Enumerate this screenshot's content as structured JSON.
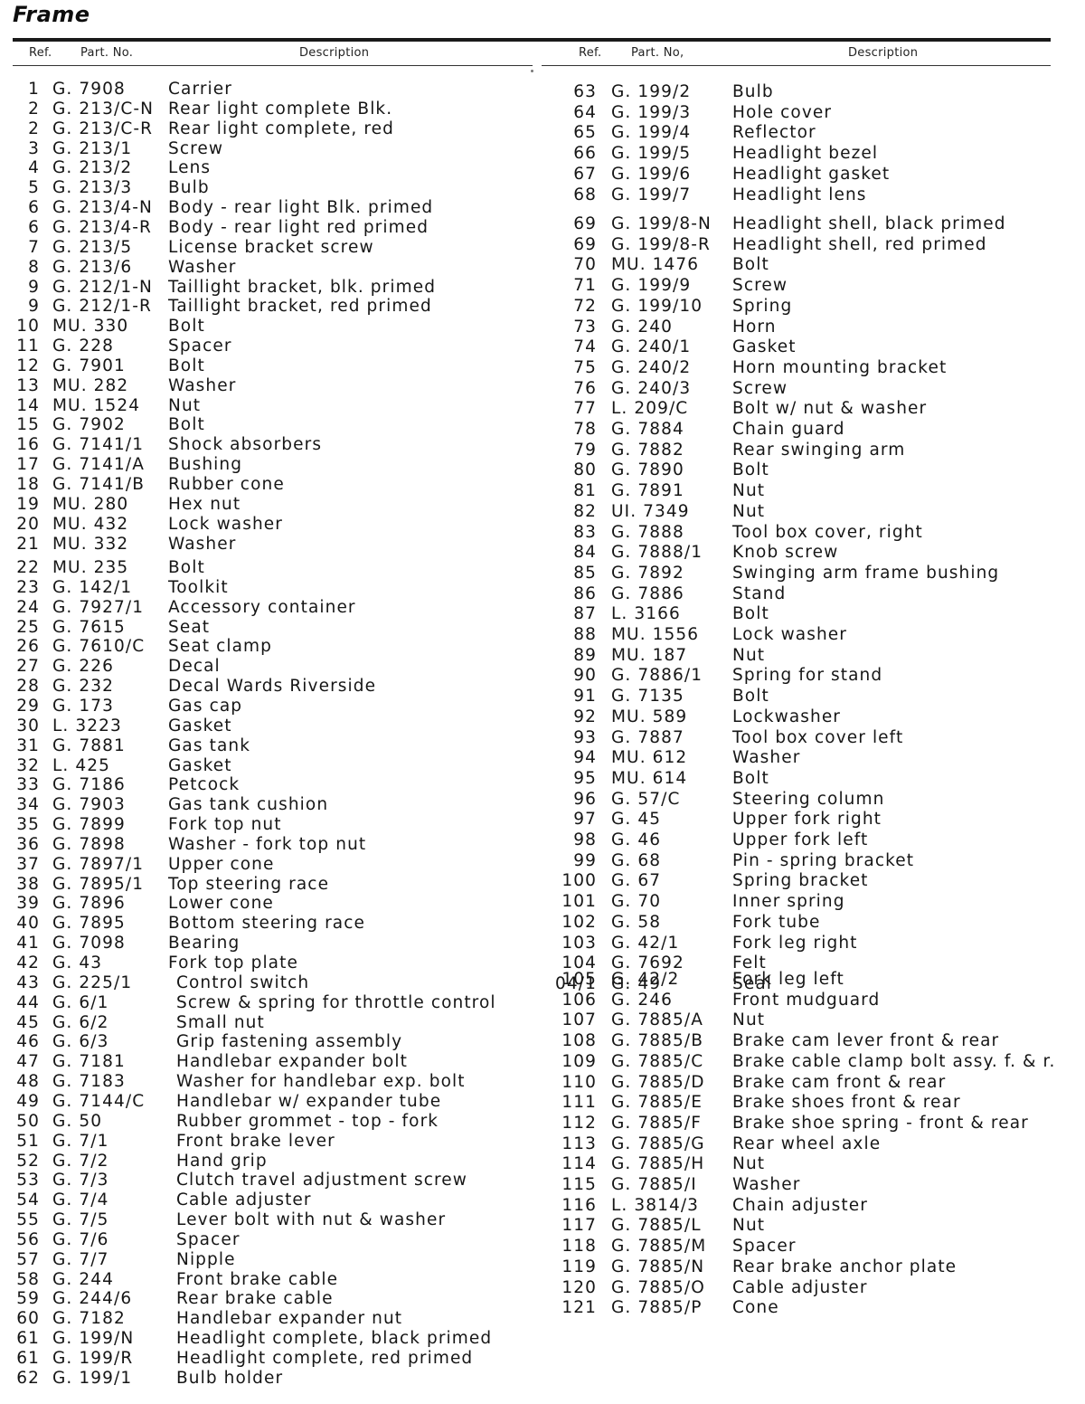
{
  "page": {
    "title": "Frame",
    "headers": {
      "ref": "Ref.",
      "part_no": "Part. No.",
      "description": "Description",
      "part_no_right": "Part. No,"
    }
  },
  "left_column": [
    {
      "ref": "1",
      "part_no": "G. 7908",
      "description": "Carrier"
    },
    {
      "ref": "2",
      "part_no": "G. 213/C-N",
      "description": "Rear light complete Blk."
    },
    {
      "ref": "2",
      "part_no": "G. 213/C-R",
      "description": "Rear light complete, red"
    },
    {
      "ref": "3",
      "part_no": "G. 213/1",
      "description": "Screw"
    },
    {
      "ref": "4",
      "part_no": "G. 213/2",
      "description": "Lens"
    },
    {
      "ref": "5",
      "part_no": "G. 213/3",
      "description": "Bulb"
    },
    {
      "ref": "6",
      "part_no": "G. 213/4-N",
      "description": "Body - rear light Blk. primed"
    },
    {
      "ref": "6",
      "part_no": "G. 213/4-R",
      "description": "Body - rear light red primed"
    },
    {
      "ref": "7",
      "part_no": "G. 213/5",
      "description": "License bracket screw"
    },
    {
      "ref": "8",
      "part_no": "G. 213/6",
      "description": "Washer"
    },
    {
      "ref": "9",
      "part_no": "G. 212/1-N",
      "description": "Taillight bracket, blk. primed"
    },
    {
      "ref": "9",
      "part_no": "G. 212/1-R",
      "description": "Taillight bracket, red primed"
    },
    {
      "ref": "10",
      "part_no": "MU. 330",
      "description": "Bolt"
    },
    {
      "ref": "11",
      "part_no": "G. 228",
      "description": "Spacer"
    },
    {
      "ref": "12",
      "part_no": "G. 7901",
      "description": "Bolt"
    },
    {
      "ref": "13",
      "part_no": "MU. 282",
      "description": "Washer"
    },
    {
      "ref": "14",
      "part_no": "MU. 1524",
      "description": "Nut"
    },
    {
      "ref": "15",
      "part_no": "G. 7902",
      "description": "Bolt"
    },
    {
      "ref": "16",
      "part_no": "G. 7141/1",
      "description": "Shock absorbers"
    },
    {
      "ref": "17",
      "part_no": "G. 7141/A",
      "description": "Bushing"
    },
    {
      "ref": "18",
      "part_no": "G. 7141/B",
      "description": "Rubber cone"
    },
    {
      "ref": "19",
      "part_no": "MU. 280",
      "description": "Hex nut"
    },
    {
      "ref": "20",
      "part_no": "MU. 432",
      "description": "Lock washer"
    },
    {
      "ref": "21",
      "part_no": "MU. 332",
      "description": "Washer"
    },
    {
      "ref": "22",
      "part_no": "MU. 235",
      "description": "Bolt"
    },
    {
      "ref": "23",
      "part_no": "G. 142/1",
      "description": "Toolkit"
    },
    {
      "ref": "24",
      "part_no": "G. 7927/1",
      "description": "Accessory container"
    },
    {
      "ref": "25",
      "part_no": "G. 7615",
      "description": "Seat"
    },
    {
      "ref": "26",
      "part_no": "G. 7610/C",
      "description": "Seat clamp"
    },
    {
      "ref": "27",
      "part_no": "G. 226",
      "description": "Decal"
    },
    {
      "ref": "28",
      "part_no": "G. 232",
      "description": "Decal Wards Riverside"
    },
    {
      "ref": "29",
      "part_no": "G. 173",
      "description": "Gas cap"
    },
    {
      "ref": "30",
      "part_no": "L. 3223",
      "description": "Gasket"
    },
    {
      "ref": "31",
      "part_no": "G. 7881",
      "description": "Gas tank"
    },
    {
      "ref": "32",
      "part_no": "L. 425",
      "description": "Gasket"
    },
    {
      "ref": "33",
      "part_no": "G. 7186",
      "description": "Petcock"
    },
    {
      "ref": "34",
      "part_no": "G. 7903",
      "description": "Gas tank cushion"
    },
    {
      "ref": "35",
      "part_no": "G. 7899",
      "description": "Fork top nut"
    },
    {
      "ref": "36",
      "part_no": "G. 7898",
      "description": "Washer - fork top nut"
    },
    {
      "ref": "37",
      "part_no": "G. 7897/1",
      "description": "Upper cone"
    },
    {
      "ref": "38",
      "part_no": "G. 7895/1",
      "description": "Top steering race"
    },
    {
      "ref": "39",
      "part_no": "G. 7896",
      "description": "Lower cone"
    },
    {
      "ref": "40",
      "part_no": "G. 7895",
      "description": "Bottom steering race"
    },
    {
      "ref": "41",
      "part_no": "G. 7098",
      "description": "Bearing"
    },
    {
      "ref": "42",
      "part_no": "G. 43",
      "description": "Fork top plate"
    },
    {
      "ref": "43",
      "part_no": "G. 225/1",
      "description": "Control switch"
    },
    {
      "ref": "44",
      "part_no": "G. 6/1",
      "description": "Screw & spring for throttle control"
    },
    {
      "ref": "45",
      "part_no": "G. 6/2",
      "description": "Small nut"
    },
    {
      "ref": "46",
      "part_no": "G. 6/3",
      "description": "Grip fastening assembly"
    },
    {
      "ref": "47",
      "part_no": "G. 7181",
      "description": "Handlebar expander bolt"
    },
    {
      "ref": "48",
      "part_no": "G. 7183",
      "description": "Washer for handlebar exp. bolt"
    },
    {
      "ref": "49",
      "part_no": "G. 7144/C",
      "description": "Handlebar w/ expander tube"
    },
    {
      "ref": "50",
      "part_no": "G. 50",
      "description": "Rubber grommet - top - fork"
    },
    {
      "ref": "51",
      "part_no": "G. 7/1",
      "description": "Front brake lever"
    },
    {
      "ref": "52",
      "part_no": "G. 7/2",
      "description": "Hand grip"
    },
    {
      "ref": "53",
      "part_no": "G. 7/3",
      "description": "Clutch travel adjustment screw"
    },
    {
      "ref": "54",
      "part_no": "G. 7/4",
      "description": "Cable adjuster"
    },
    {
      "ref": "55",
      "part_no": "G. 7/5",
      "description": "Lever bolt with nut & washer"
    },
    {
      "ref": "56",
      "part_no": "G. 7/6",
      "description": "Spacer"
    },
    {
      "ref": "57",
      "part_no": "G. 7/7",
      "description": "Nipple"
    },
    {
      "ref": "58",
      "part_no": "G. 244",
      "description": "Front brake cable"
    },
    {
      "ref": "59",
      "part_no": "G. 244/6",
      "description": "Rear brake cable"
    },
    {
      "ref": "60",
      "part_no": "G. 7182",
      "description": "Handlebar expander nut"
    },
    {
      "ref": "61",
      "part_no": "G. 199/N",
      "description": "Headlight complete, black primed"
    },
    {
      "ref": "61",
      "part_no": "G. 199/R",
      "description": "Headlight complete, red primed"
    },
    {
      "ref": "62",
      "part_no": "G. 199/1",
      "description": "Bulb holder"
    }
  ],
  "right_column": [
    {
      "ref": "63",
      "part_no": "G. 199/2",
      "description": "Bulb"
    },
    {
      "ref": "64",
      "part_no": "G. 199/3",
      "description": "Hole cover"
    },
    {
      "ref": "65",
      "part_no": "G. 199/4",
      "description": "Reflector"
    },
    {
      "ref": "66",
      "part_no": "G. 199/5",
      "description": "Headlight bezel"
    },
    {
      "ref": "67",
      "part_no": "G. 199/6",
      "description": "Headlight gasket"
    },
    {
      "ref": "68",
      "part_no": "G. 199/7",
      "description": "Headlight lens"
    },
    {
      "ref": "69",
      "part_no": "G. 199/8-N",
      "description": "Headlight shell, black primed"
    },
    {
      "ref": "69",
      "part_no": "G. 199/8-R",
      "description": "Headlight shell, red primed"
    },
    {
      "ref": "70",
      "part_no": "MU. 1476",
      "description": "Bolt"
    },
    {
      "ref": "71",
      "part_no": "G. 199/9",
      "description": "Screw"
    },
    {
      "ref": "72",
      "part_no": "G. 199/10",
      "description": "Spring"
    },
    {
      "ref": "73",
      "part_no": "G. 240",
      "description": "Horn"
    },
    {
      "ref": "74",
      "part_no": "G. 240/1",
      "description": "Gasket"
    },
    {
      "ref": "75",
      "part_no": "G. 240/2",
      "description": "Horn mounting bracket"
    },
    {
      "ref": "76",
      "part_no": "G. 240/3",
      "description": "Screw"
    },
    {
      "ref": "77",
      "part_no": "L. 209/C",
      "description": "Bolt w/ nut & washer"
    },
    {
      "ref": "78",
      "part_no": "G. 7884",
      "description": "Chain guard"
    },
    {
      "ref": "79",
      "part_no": "G. 7882",
      "description": "Rear swinging arm"
    },
    {
      "ref": "80",
      "part_no": "G. 7890",
      "description": "Bolt"
    },
    {
      "ref": "81",
      "part_no": "G. 7891",
      "description": "Nut"
    },
    {
      "ref": "82",
      "part_no": "UI. 7349",
      "description": "Nut"
    },
    {
      "ref": "83",
      "part_no": "G. 7888",
      "description": "Tool box cover, right"
    },
    {
      "ref": "84",
      "part_no": "G. 7888/1",
      "description": "Knob screw"
    },
    {
      "ref": "85",
      "part_no": "G. 7892",
      "description": "Swinging arm frame bushing"
    },
    {
      "ref": "86",
      "part_no": "G. 7886",
      "description": "Stand"
    },
    {
      "ref": "87",
      "part_no": "L. 3166",
      "description": "Bolt"
    },
    {
      "ref": "88",
      "part_no": "MU. 1556",
      "description": "Lock washer"
    },
    {
      "ref": "89",
      "part_no": "MU. 187",
      "description": "Nut"
    },
    {
      "ref": "90",
      "part_no": "G. 7886/1",
      "description": "Spring for stand"
    },
    {
      "ref": "91",
      "part_no": "G. 7135",
      "description": "Bolt"
    },
    {
      "ref": "92",
      "part_no": "MU. 589",
      "description": "Lockwasher"
    },
    {
      "ref": "93",
      "part_no": "G. 7887",
      "description": "Tool box cover left"
    },
    {
      "ref": "94",
      "part_no": "MU. 612",
      "description": "Washer"
    },
    {
      "ref": "95",
      "part_no": "MU. 614",
      "description": "Bolt"
    },
    {
      "ref": "96",
      "part_no": "G. 57/C",
      "description": "Steering column"
    },
    {
      "ref": "97",
      "part_no": "G. 45",
      "description": "Upper fork right"
    },
    {
      "ref": "98",
      "part_no": "G. 46",
      "description": "Upper fork left"
    },
    {
      "ref": "99",
      "part_no": "G. 68",
      "description": "Pin - spring bracket"
    },
    {
      "ref": "100",
      "part_no": "G. 67",
      "description": "Spring bracket"
    },
    {
      "ref": "101",
      "part_no": "G. 70",
      "description": "Inner spring"
    },
    {
      "ref": "102",
      "part_no": "G. 58",
      "description": "Fork tube"
    },
    {
      "ref": "103",
      "part_no": "G. 42/1",
      "description": "Fork leg right"
    },
    {
      "ref": "104",
      "part_no": "G. 7692",
      "description": "Felt"
    },
    {
      "ref": "04/1",
      "part_no": "G. 49",
      "description": "Seal"
    },
    {
      "ref": "105",
      "part_no": "G. 42/2",
      "description": "Fork leg left"
    },
    {
      "ref": "106",
      "part_no": "G. 246",
      "description": "Front mudguard"
    },
    {
      "ref": "107",
      "part_no": "G. 7885/A",
      "description": "Nut"
    },
    {
      "ref": "108",
      "part_no": "G. 7885/B",
      "description": "Brake cam lever front & rear"
    },
    {
      "ref": "109",
      "part_no": "G. 7885/C",
      "description": "Brake cable clamp bolt assy. f. & r."
    },
    {
      "ref": "110",
      "part_no": "G. 7885/D",
      "description": "Brake cam front & rear"
    },
    {
      "ref": "111",
      "part_no": "G. 7885/E",
      "description": "Brake shoes front & rear"
    },
    {
      "ref": "112",
      "part_no": "G. 7885/F",
      "description": "Brake shoe spring - front & rear"
    },
    {
      "ref": "113",
      "part_no": "G. 7885/G",
      "description": "Rear wheel axle"
    },
    {
      "ref": "114",
      "part_no": "G. 7885/H",
      "description": "Nut"
    },
    {
      "ref": "115",
      "part_no": "G. 7885/I",
      "description": "Washer"
    },
    {
      "ref": "116",
      "part_no": "L. 3814/3",
      "description": "Chain adjuster"
    },
    {
      "ref": "117",
      "part_no": "G. 7885/L",
      "description": "Nut"
    },
    {
      "ref": "118",
      "part_no": "G. 7885/M",
      "description": "Spacer"
    },
    {
      "ref": "119",
      "part_no": "G. 7885/N",
      "description": "Rear brake anchor plate"
    },
    {
      "ref": "120",
      "part_no": "G. 7885/O",
      "description": "Cable adjuster"
    },
    {
      "ref": "121",
      "part_no": "G. 7885/P",
      "description": "Cone"
    }
  ]
}
